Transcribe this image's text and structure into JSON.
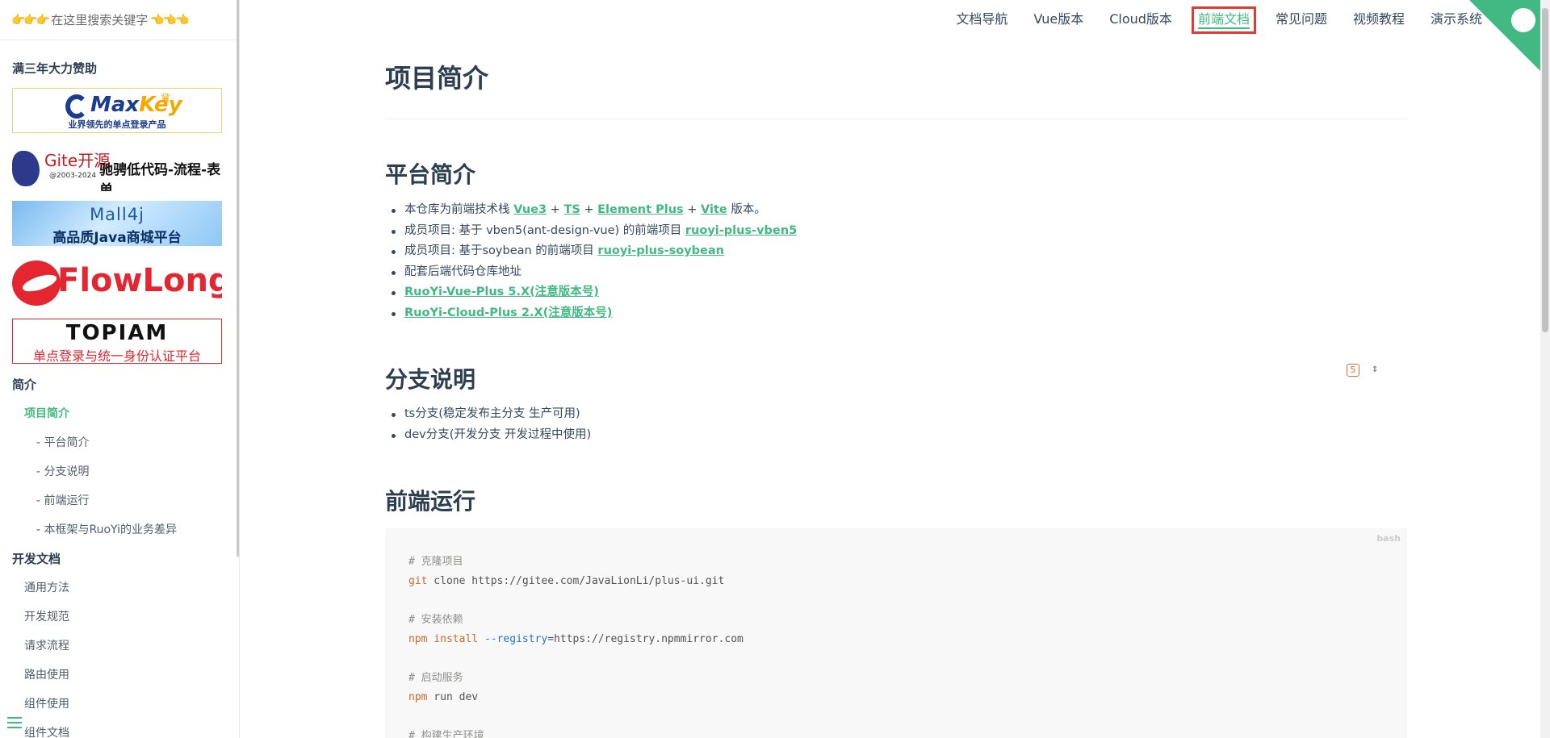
{
  "search": {
    "placeholder": "在这里搜索关键字",
    "hand_left": "👉👉👉",
    "hand_right": "👈👈👈"
  },
  "sidebar": {
    "sponsor_title": "满三年大力赞助",
    "ads": {
      "maxkey": {
        "name_a": "Max",
        "name_b": "Key",
        "sub": "业界领先的单点登录产品"
      },
      "gitee": {
        "brand": "Gite开源",
        "year": "@2003-2024",
        "slogan": "驰骋低代码-流程-表单"
      },
      "mall4j": {
        "line1": "Mall4j",
        "line2": "高品质Java商城平台"
      },
      "flowlong": {
        "text": "FlowLong"
      },
      "topiam": {
        "line1": "TOPIAM",
        "line2": "单点登录与统一身份认证平台"
      }
    },
    "sections": [
      {
        "title": "简介"
      },
      {
        "title": "开发文档"
      }
    ],
    "intro_items": [
      {
        "label": "项目简介"
      },
      {
        "label": "- 平台简介"
      },
      {
        "label": "- 分支说明"
      },
      {
        "label": "- 前端运行"
      },
      {
        "label": "- 本框架与RuoYi的业务差异"
      }
    ],
    "dev_items": [
      {
        "label": "通用方法"
      },
      {
        "label": "开发规范"
      },
      {
        "label": "请求流程"
      },
      {
        "label": "路由使用"
      },
      {
        "label": "组件使用"
      },
      {
        "label": "组件文档"
      }
    ]
  },
  "topnav": [
    {
      "label": "文档导航"
    },
    {
      "label": "Vue版本"
    },
    {
      "label": "Cloud版本"
    },
    {
      "label": "前端文档"
    },
    {
      "label": "常见问题"
    },
    {
      "label": "视频教程"
    },
    {
      "label": "演示系统"
    }
  ],
  "main": {
    "title": "项目简介",
    "platform": {
      "heading": "平台简介",
      "item1": {
        "prefix": "本仓库为前端技术栈 ",
        "vue3": "Vue3",
        "plus1": " + ",
        "ts": "TS",
        "plus2": " + ",
        "ep": "Element Plus",
        "plus3": " + ",
        "vite": "Vite",
        "suffix": " 版本。"
      },
      "item2": {
        "prefix": "成员项目: 基于 vben5(ant-design-vue) 的前端项目 ",
        "link": "ruoyi-plus-vben5"
      },
      "item3": {
        "prefix": "成员项目: 基于soybean 的前端项目 ",
        "link": "ruoyi-plus-soybean"
      },
      "item4": "配套后端代码仓库地址",
      "item5": "RuoYi-Vue-Plus 5.X(注意版本号)",
      "item6": "RuoYi-Cloud-Plus 2.X(注意版本号)"
    },
    "branch": {
      "heading": "分支说明",
      "items": [
        "ts分支(稳定发布主分支 生产可用)",
        "dev分支(开发分支 开发过程中使用)"
      ]
    },
    "run": {
      "heading": "前端运行",
      "code_lang": "bash",
      "lines": {
        "c1": "# 克隆项目",
        "l1_cmd": "git",
        "l1_rest": " clone https://gitee.com/JavaLionLi/plus-ui.git",
        "c2": "# 安装依赖",
        "l2_cmd": "npm",
        "l2_kw": " install ",
        "l2_flag": "--registry",
        "l2_rest": "=https://registry.npmmirror.com",
        "c3": "# 启动服务",
        "l3_cmd": "npm",
        "l3_rest": " run dev",
        "c4": "# 构建生产环境"
      }
    }
  },
  "colors": {
    "accent": "#42b983",
    "text": "#34495e",
    "highlight_box": "#e53935"
  }
}
